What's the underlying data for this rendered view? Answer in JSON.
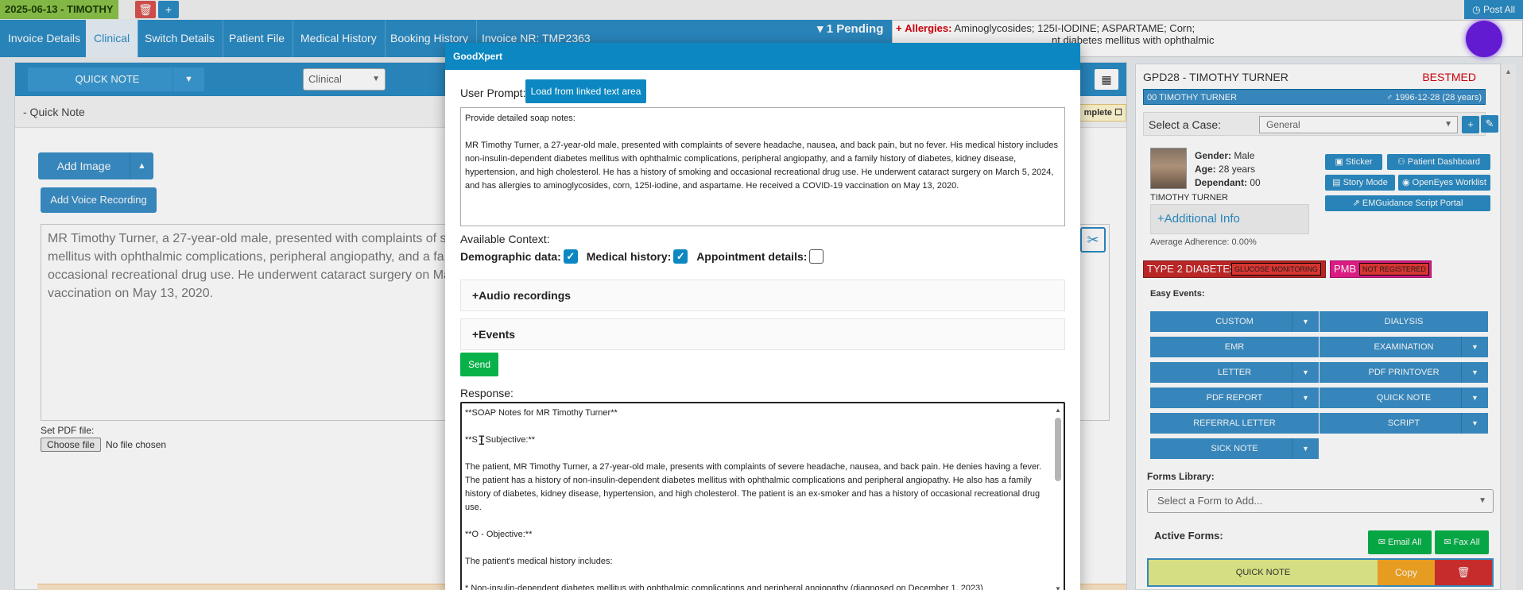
{
  "topbar": {
    "date_label": "2025-06-13 - TIMOTHY",
    "delete_glyph": "🗑",
    "add_glyph": "+",
    "post_all": "Post All"
  },
  "tabs": [
    {
      "label": "Invoice Details"
    },
    {
      "label": "Clinical"
    },
    {
      "label": "Switch Details"
    },
    {
      "label": "Patient File"
    },
    {
      "label": "Medical History"
    },
    {
      "label": "Booking History"
    },
    {
      "label": "Invoice NR: TMP2363"
    }
  ],
  "pending": "▾ 1 Pending",
  "allergies": {
    "prefix": "+",
    "label": "Allergies:",
    "value": "Aminoglycosides; 125I-IODINE; ASPARTAME; Corn;",
    "line2": "nt diabetes mellitus with ophthalmic"
  },
  "left": {
    "quick_note_btn": "QUICK NOTE",
    "clinical_select": "Clinical",
    "header": "- Quick Note",
    "complete": "mplete",
    "add_image": "Add Image",
    "add_voice": "Add Voice Recording",
    "note_lines": [
      "MR Timothy Turner, a 27-year-old male, presented with complaints of s",
      "mellitus with ophthalmic complications, peripheral angiopathy, and a fa",
      "occasional recreational drug use. He underwent cataract surgery on Ma",
      "vaccination on May 13, 2020."
    ],
    "pdf_label": "Set PDF file:",
    "choose_file": "Choose file",
    "no_file": "No file chosen"
  },
  "modal": {
    "title": "GoodXpert",
    "user_prompt_label": "User Prompt:",
    "load_btn": "Load from linked text area",
    "prompt_line1": "Provide detailed soap notes:",
    "prompt_body": "MR Timothy Turner, a 27-year-old male, presented with complaints of severe headache, nausea, and back pain, but no fever. His medical history includes non-insulin-dependent diabetes mellitus with ophthalmic complications, peripheral angiopathy, and a family history of diabetes, kidney disease, hypertension, and high cholesterol. He has a history of smoking and occasional recreational drug use. He underwent cataract surgery on March 5, 2024, and has allergies to aminoglycosides, corn, 125I-iodine, and aspartame. He received a COVID-19 vaccination on May 13, 2020.",
    "available_context": "Available Context:",
    "ctx": {
      "demographic": "Demographic data:",
      "medical": "Medical history:",
      "appointment": "Appointment details:",
      "demographic_checked": true,
      "medical_checked": true,
      "appointment_checked": false
    },
    "audio": "+Audio recordings",
    "events": "+Events",
    "send": "Send",
    "response_label": "Response:",
    "response": {
      "l1": "**SOAP Notes for MR Timothy Turner**",
      "l2": "**S - Subjective:**",
      "l3": "The patient, MR Timothy Turner, a 27-year-old male, presents with complaints of severe headache, nausea, and back pain. He denies having a fever. The patient has a history of non-insulin-dependent diabetes mellitus with ophthalmic complications and peripheral angiopathy. He also has a family history of diabetes, kidney disease, hypertension, and high cholesterol. The patient is an ex-smoker and has a history of occasional recreational drug use.",
      "l4": "**O - Objective:**",
      "l5": "The patient's medical history includes:",
      "l6": "* Non-insulin-dependent diabetes mellitus with ophthalmic complications and peripheral angiopathy (diagnosed on December 1, 2023)"
    }
  },
  "right": {
    "title": "GPD28 - TIMOTHY TURNER",
    "medical_aid": "BESTMED",
    "name_bar": "00 TIMOTHY TURNER",
    "dob": "♂ 1996-12-28 (28 years)",
    "case_label": "Select a Case:",
    "case_value": "General",
    "gender_label": "Gender:",
    "gender": "Male",
    "age_label": "Age:",
    "age": "28 years",
    "dependant_label": "Dependant:",
    "dependant": "00",
    "patient_name": "TIMOTHY TURNER",
    "additional_info": "+Additional Info",
    "adherence": "Average Adherence: 0.00%",
    "sticker": "Sticker",
    "patient_dashboard": "Patient Dashboard",
    "story_mode": "Story Mode",
    "openeyes": "OpenEyes Worklist",
    "emguidance": "EMGuidance Script Portal",
    "badge1": "TYPE 2 DIABETES",
    "badge1_sub": "GLUCOSE MONITORING",
    "badge2": "PMB",
    "badge2_sub": "NOT REGISTERED",
    "easy_events": "Easy Events:",
    "events": [
      {
        "label": "CUSTOM",
        "caret": true
      },
      {
        "label": "DIALYSIS",
        "caret": false
      },
      {
        "label": "EMR",
        "caret": false
      },
      {
        "label": "EXAMINATION",
        "caret": true
      },
      {
        "label": "LETTER",
        "caret": true
      },
      {
        "label": "PDF PRINTOVER",
        "caret": true
      },
      {
        "label": "PDF REPORT",
        "caret": true
      },
      {
        "label": "QUICK NOTE",
        "caret": true
      },
      {
        "label": "REFERRAL LETTER",
        "caret": false
      },
      {
        "label": "SCRIPT",
        "caret": true
      },
      {
        "label": "SICK NOTE",
        "caret": true
      }
    ],
    "forms_library": "Forms Library:",
    "forms_select": "Select a Form to Add...",
    "active_forms": "Active Forms:",
    "email_all": "Email All",
    "fax_all": "Fax All",
    "form_quick_note": "QUICK NOTE",
    "copy": "Copy"
  }
}
